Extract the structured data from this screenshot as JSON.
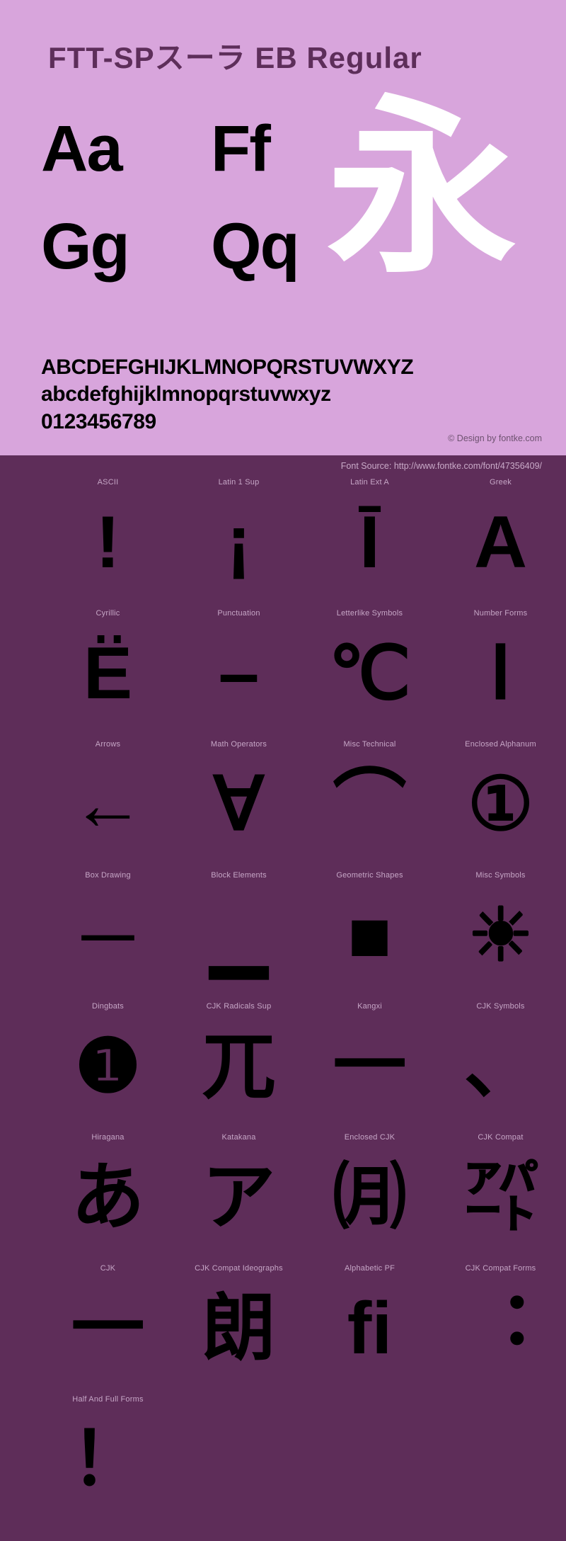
{
  "font": {
    "title": "FTT-SPスーラ EB Regular",
    "title_color": "#5d2e5a",
    "top_bg": "#d8a5dc",
    "bottom_bg": "#5e2d59",
    "glyph_color": "#000000",
    "hero_color": "#ffffff"
  },
  "big_samples": {
    "aa": "Aa",
    "ff": "Ff",
    "gg": "Gg",
    "qq": "Qq",
    "hero": "永"
  },
  "alphabet": {
    "uppercase": "ABCDEFGHIJKLMNOPQRSTUVWXYZ",
    "lowercase": "abcdefghijklmnopqrstuvwxyz",
    "digits": "0123456789"
  },
  "credit": "© Design by fontke.com",
  "source": "Font Source: http://www.fontke.com/font/47356409/",
  "unicode_blocks": [
    [
      {
        "label": "ASCII",
        "glyph": "!"
      },
      {
        "label": "Latin 1 Sup",
        "glyph": "¡"
      },
      {
        "label": "Latin Ext A",
        "glyph": "Ī"
      },
      {
        "label": "Greek",
        "glyph": "Α"
      }
    ],
    [
      {
        "label": "Cyrillic",
        "glyph": "Ё"
      },
      {
        "label": "Punctuation",
        "glyph": "–"
      },
      {
        "label": "Letterlike Symbols",
        "glyph": "℃"
      },
      {
        "label": "Number Forms",
        "glyph": "Ⅰ"
      }
    ],
    [
      {
        "label": "Arrows",
        "glyph": "←"
      },
      {
        "label": "Math Operators",
        "glyph": "∀"
      },
      {
        "label": "Misc Technical",
        "glyph": "⌒"
      },
      {
        "label": "Enclosed Alphanum",
        "glyph": "①"
      }
    ],
    [
      {
        "label": "Box Drawing",
        "glyph": "─"
      },
      {
        "label": "Block Elements",
        "glyph": "▁"
      },
      {
        "label": "Geometric Shapes",
        "glyph": "■"
      },
      {
        "label": "Misc Symbols",
        "glyph": "☀"
      }
    ],
    [
      {
        "label": "Dingbats",
        "glyph": "❶"
      },
      {
        "label": "CJK Radicals Sup",
        "glyph": "兀"
      },
      {
        "label": "Kangxi",
        "glyph": "一"
      },
      {
        "label": "CJK Symbols",
        "glyph": "、"
      }
    ],
    [
      {
        "label": "Hiragana",
        "glyph": "あ"
      },
      {
        "label": "Katakana",
        "glyph": "ア"
      },
      {
        "label": "Enclosed CJK",
        "glyph": "㈪"
      },
      {
        "label": "CJK Compat",
        "glyph": "㌀"
      }
    ],
    [
      {
        "label": "CJK",
        "glyph": "一"
      },
      {
        "label": "CJK Compat Ideographs",
        "glyph": "朗"
      },
      {
        "label": "Alphabetic PF",
        "glyph": "ﬁ"
      },
      {
        "label": "CJK Compat Forms",
        "glyph": "︓"
      }
    ],
    [
      {
        "label": "Half And Full Forms",
        "glyph": "！"
      }
    ]
  ]
}
